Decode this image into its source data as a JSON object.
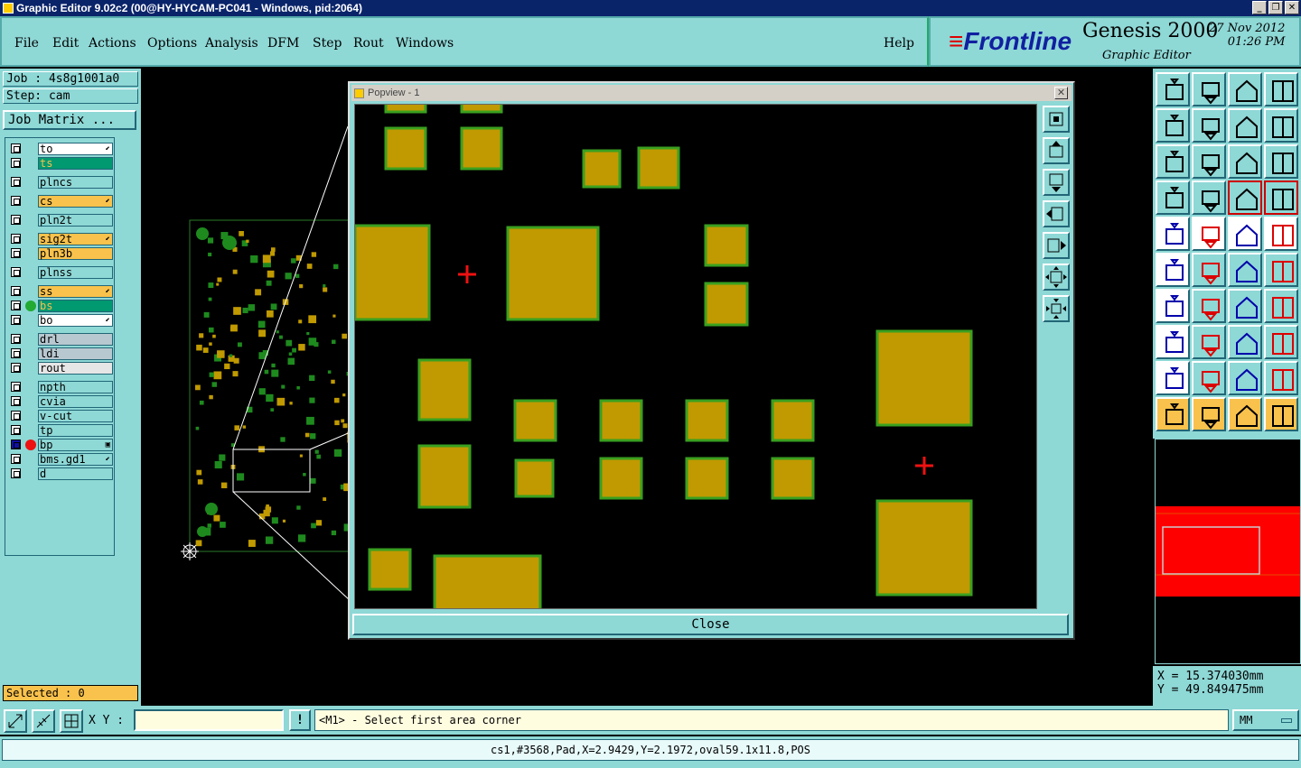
{
  "window": {
    "title": "Graphic Editor 9.02c2 (00@HY-HYCAM-PC041 - Windows, pid:2064)",
    "min": "_",
    "max": "❐",
    "close": "✕"
  },
  "menu": [
    {
      "label": "File"
    },
    {
      "label": "Edit"
    },
    {
      "label": "Actions"
    },
    {
      "label": "Options"
    },
    {
      "label": "Analysis"
    },
    {
      "label": "DFM"
    },
    {
      "label": "Step"
    },
    {
      "label": "Rout"
    },
    {
      "label": "Windows"
    }
  ],
  "help_label": "Help",
  "brand": {
    "logo_rest": "Frontline",
    "logo_mark": "≡",
    "product": "Genesis 2000",
    "subtitle": "Graphic Editor",
    "date": "27 Nov 2012",
    "time": "01:26 PM"
  },
  "job": {
    "job_line": "Job : 4s8g1001a0",
    "step_line": "Step: cam",
    "matrix_label": "Job Matrix ..."
  },
  "layers": [
    {
      "name": "to",
      "bg": "#ffffff",
      "arrow": "⬋"
    },
    {
      "name": "ts",
      "bg": "#009970",
      "arrow": ""
    },
    {
      "name": "plncs",
      "bg": "#8ed8d6",
      "arrow": ""
    },
    {
      "name": "cs",
      "bg": "#f9c24c",
      "arrow": "⬋"
    },
    {
      "name": "pln2t",
      "bg": "#8ed8d6",
      "arrow": ""
    },
    {
      "name": "sig2t",
      "bg": "#f9c24c",
      "arrow": "⬋"
    },
    {
      "name": "pln3b",
      "bg": "#f9c24c",
      "arrow": ""
    },
    {
      "name": "plnss",
      "bg": "#8ed8d6",
      "arrow": ""
    },
    {
      "name": "ss",
      "bg": "#f9c24c",
      "arrow": "⬋"
    },
    {
      "name": "bs",
      "bg": "#009970",
      "arrow": "",
      "dot": "#22aa33"
    },
    {
      "name": "bo",
      "bg": "#ffffff",
      "arrow": "⬋"
    },
    {
      "name": "drl",
      "bg": "#b8c8d0",
      "arrow": ""
    },
    {
      "name": "ldi",
      "bg": "#b8c8d0",
      "arrow": ""
    },
    {
      "name": "rout",
      "bg": "#e6e6e6",
      "arrow": ""
    },
    {
      "name": "npth",
      "bg": "#8ed8d6",
      "arrow": ""
    },
    {
      "name": "cvia",
      "bg": "#8ed8d6",
      "arrow": ""
    },
    {
      "name": "v-cut",
      "bg": "#8ed8d6",
      "arrow": ""
    },
    {
      "name": "tp",
      "bg": "#8ed8d6",
      "arrow": ""
    },
    {
      "name": "bp",
      "bg": "#8ed8d6",
      "arrow": "▣",
      "dot": "#ee1111",
      "work": true
    },
    {
      "name": "bms.gd1",
      "bg": "#8ed8d6",
      "arrow": "⬋"
    },
    {
      "name": "d",
      "bg": "#8ed8d6",
      "arrow": ""
    }
  ],
  "selected_label": "Selected : 0",
  "popview": {
    "title": "Popview - 1",
    "close_label": "Close",
    "close_x": "✕"
  },
  "coords": {
    "x_line": "X =  15.374030mm",
    "y_line": "Y =  49.849475mm"
  },
  "bottom": {
    "xy_label": "X Y :",
    "xy_value": "",
    "warn": "!",
    "prompt": "<M1> - Select first area corner",
    "unit": "MM"
  },
  "status_text": "cs1,#3568,Pad,X=2.9429,Y=2.1972,oval59.1x11.8,POS",
  "colors": {
    "panel": "#8ed8d6",
    "pad_fill": "#c09a00",
    "pad_edge": "#3aa020",
    "highlight": "#f9c24c"
  }
}
